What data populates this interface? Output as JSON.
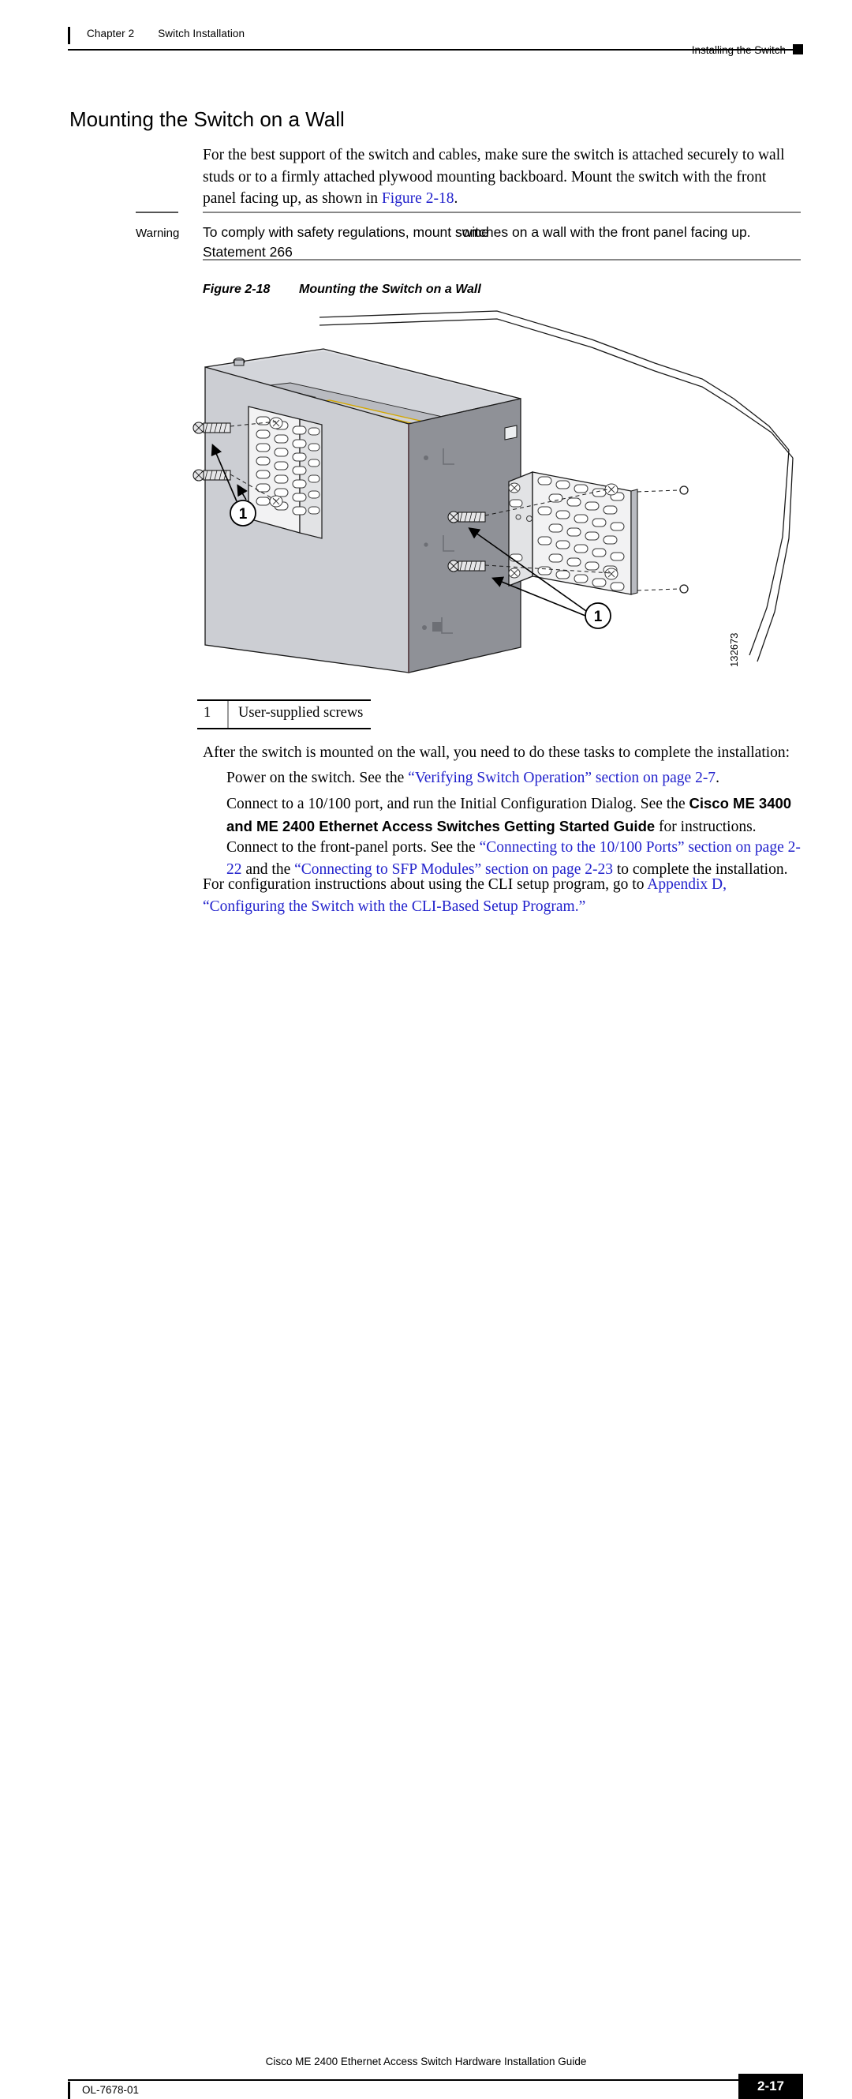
{
  "header": {
    "chapter": "Chapter 2",
    "chapter_title": "Switch Installation",
    "running_head": "Installing the Switch"
  },
  "page_title": "Mounting the Switch on a Wall",
  "intro": {
    "text_before_link": "For the best support of the switch and cables, make sure the switch is attached securely to wall studs or to a firmly attached plywood mounting backboard. Mount the switch with the front panel facing up, as shown in ",
    "link": "Figure 2-18",
    "text_after_link": "."
  },
  "warning": {
    "label": "Warning",
    "line1_a": "To comply with safety regulations, mount ",
    "line1_overlap_back": "switches",
    "line1_overlap_front": "some",
    "line1_b": " on a wall with the front panel facing up.",
    "line2": "Statement 266"
  },
  "figure": {
    "number": "Figure 2-18",
    "title": "Mounting the Switch on a Wall",
    "art_id": "132673",
    "callout_number": "1"
  },
  "legend": {
    "number": "1",
    "text": "User-supplied screws"
  },
  "after_figure": {
    "lead": "After the switch is mounted on the wall, you need to do these tasks to complete the installation:",
    "items": [
      {
        "seg1": "Power on the switch. See the ",
        "link1": "“Verifying Switch Operation” section on page 2-7",
        "seg2": "."
      },
      {
        "seg1": "Connect to a 10/100 port, and run the Initial Configuration Dialog. See the ",
        "bold1": "Cisco ME 3400 and ME 2400 Ethernet Access Switches Getting Started Guide",
        "seg2": " for instructions."
      },
      {
        "seg1": "Connect to the front-panel ports. See the ",
        "link1": "“Connecting to the 10/100 Ports” section on page 2-22",
        "seg2": " and the ",
        "link2": "“Connecting to SFP Modules” section on page 2-23",
        "seg3": " to complete the installation."
      }
    ],
    "closing": {
      "seg1": "For configuration instructions about using the CLI setup program, go to ",
      "link1": "Appendix D, “Configuring the Switch with the CLI-Based Setup Program.”"
    }
  },
  "footer": {
    "doc_title": "Cisco ME 2400 Ethernet Access Switch Hardware Installation Guide",
    "doc_number": "OL-7678-01",
    "page_number": "2-17"
  },
  "colors": {
    "link": "#2222cc",
    "text": "#000000",
    "rule": "#000000",
    "chassis_face": "#ccced3",
    "chassis_side": "#8f9197",
    "chassis_top": "#dfe0e4",
    "bracket": "#f2f2f3"
  }
}
